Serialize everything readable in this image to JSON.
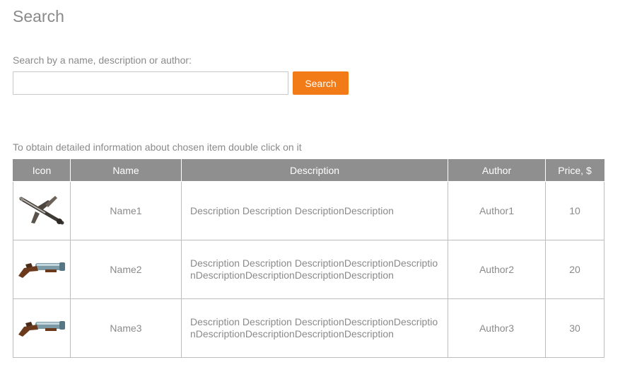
{
  "page": {
    "title": "Search"
  },
  "search": {
    "label": "Search by a name, description or author:",
    "value": "",
    "placeholder": "",
    "button_label": "Search"
  },
  "hint": "To obtain detailed information about chosen item double click on it",
  "table": {
    "headers": [
      "Icon",
      "Name",
      "Description",
      "Author",
      "Price, $"
    ],
    "rows": [
      {
        "icon": "crossbow-icon",
        "name": "Name1",
        "description": "Description Description DescriptionDescription",
        "author": "Author1",
        "price": "10"
      },
      {
        "icon": "flintlock-pistol-icon",
        "name": "Name2",
        "description": "Description Description DescriptionDescriptionDescriptionDescriptionDescriptionDescriptionDescription",
        "author": "Author2",
        "price": "20"
      },
      {
        "icon": "flintlock-pistol-icon",
        "name": "Name3",
        "description": "Description Description DescriptionDescriptionDescriptionDescriptionDescriptionDescriptionDescription",
        "author": "Author3",
        "price": "30"
      }
    ]
  },
  "colors": {
    "accent": "#f27b18",
    "header_bg": "#8f8f8f",
    "text": "#8a8a8a"
  }
}
